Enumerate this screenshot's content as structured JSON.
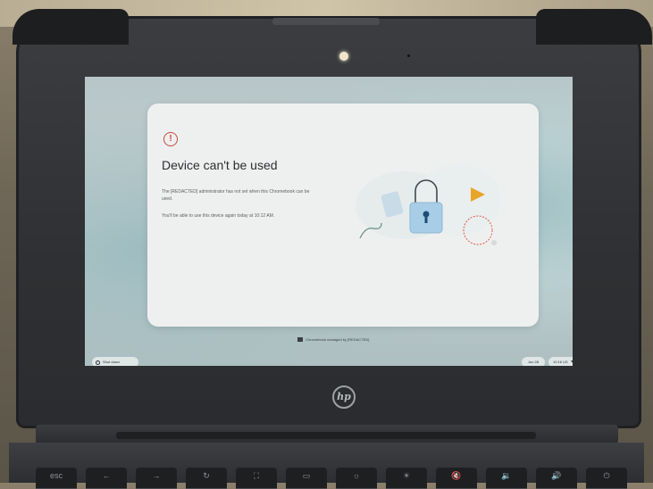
{
  "dialog": {
    "alert_glyph": "!",
    "title": "Device can't be used",
    "message_1": "The [REDACTED] administrator has not set when this Chromebook can be used.",
    "message_2": "You'll be able to use this device again today at 10:12 AM."
  },
  "footer": {
    "managed_text": "Chromebook managed by [REDACTED]"
  },
  "shelf": {
    "shutdown_label": "Shut down",
    "date": "Jun 28",
    "time": "10:16 US"
  },
  "device": {
    "brand": "hp"
  },
  "keyboard": {
    "keys": [
      "esc",
      "←",
      "→",
      "↻",
      "⛶",
      "▭",
      "☼",
      "☀",
      "🔇",
      "🔉",
      "🔊",
      "⏻"
    ]
  },
  "colors": {
    "alert_red": "#c44a3a",
    "lock_blue": "#a8cde6",
    "triangle_orange": "#e7a52a",
    "screen_teal": "#a9c4c6"
  },
  "icons": {
    "alert": "alert-circle-icon",
    "lock": "padlock-icon",
    "power": "power-icon",
    "wifi": "wifi-icon",
    "battery": "battery-icon",
    "managed": "briefcase-icon"
  }
}
